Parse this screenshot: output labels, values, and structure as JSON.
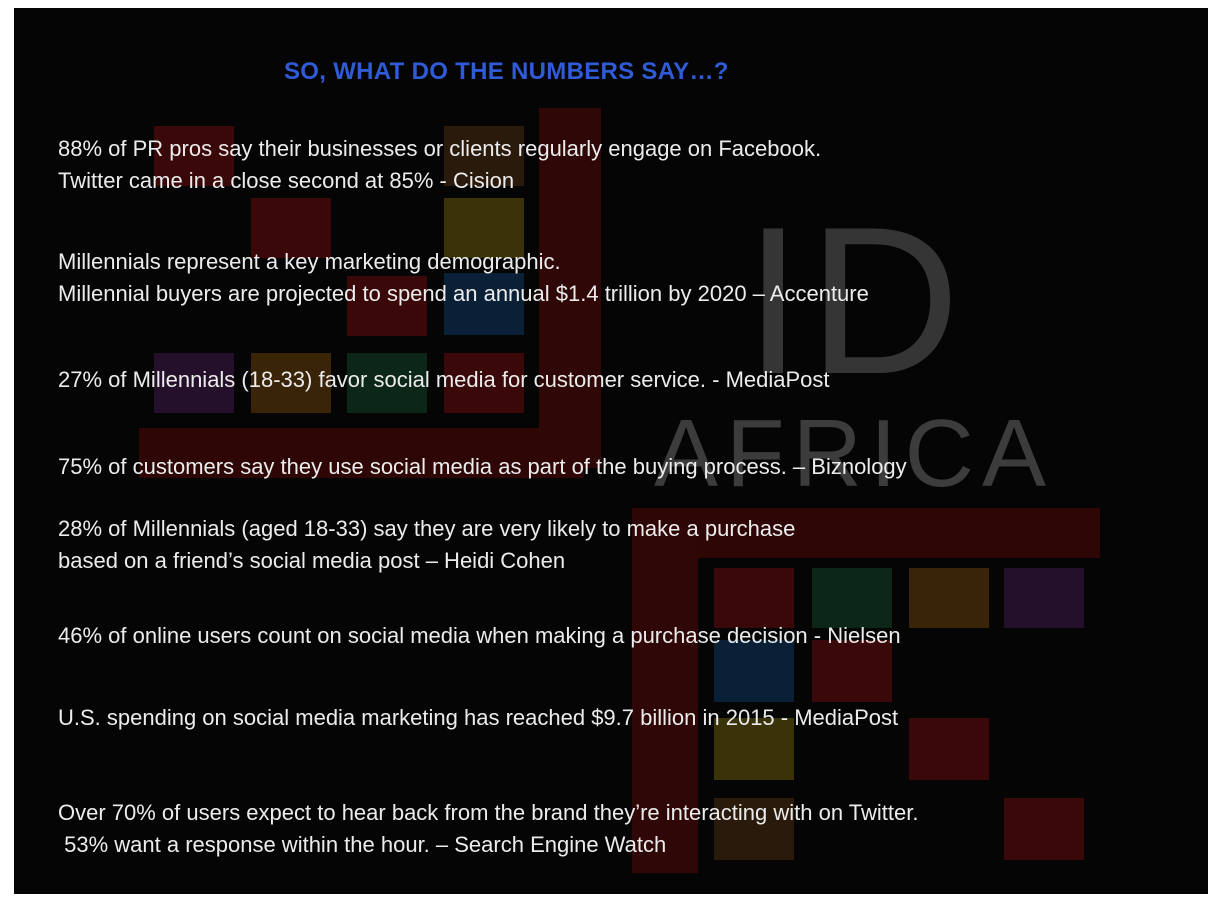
{
  "slide": {
    "title": "SO, WHAT DO THE NUMBERS SAY…?",
    "watermark": {
      "line1": "ID",
      "line2": "AFRICA"
    },
    "stats": [
      {
        "line1": "88% of PR pros say their businesses or clients regularly engage on Facebook.",
        "line2": "Twitter came in a close second at 85% - Cision"
      },
      {
        "line1": "Millennials represent a key marketing demographic.",
        "line2": "Millennial buyers are projected to spend an annual $1.4 trillion by 2020 – Accenture"
      },
      {
        "line1": "27% of Millennials (18-33) favor social media for customer service. - MediaPost"
      },
      {
        "line1": "75% of customers say they use social media as part of the buying process. – Biznology"
      },
      {
        "line1": "28% of Millennials (aged 18-33) say they are very likely to make a purchase",
        "line2": "based on a friend’s social media post – Heidi Cohen"
      },
      {
        "line1": "46% of online users count on social media when making a purchase decision - Nielsen"
      },
      {
        "line1": "U.S. spending on social media marketing has reached $9.7 billion in 2015 - MediaPost"
      },
      {
        "line1": "Over 70% of users expect to hear back from the brand they’re interacting with on Twitter.",
        "line2": " 53% want a response within the hour. – Search Engine Watch"
      }
    ]
  },
  "colors": {
    "background": "#050505",
    "title": "#2f5bd6",
    "text": "#ececec",
    "watermark": "#3a3a3a",
    "deco_red": "#3a0808",
    "deco_olive": "#3a3208",
    "deco_blue": "#0a2036",
    "deco_green": "#0c2618",
    "deco_purple": "#24102a",
    "deco_brown": "#3a2408"
  }
}
